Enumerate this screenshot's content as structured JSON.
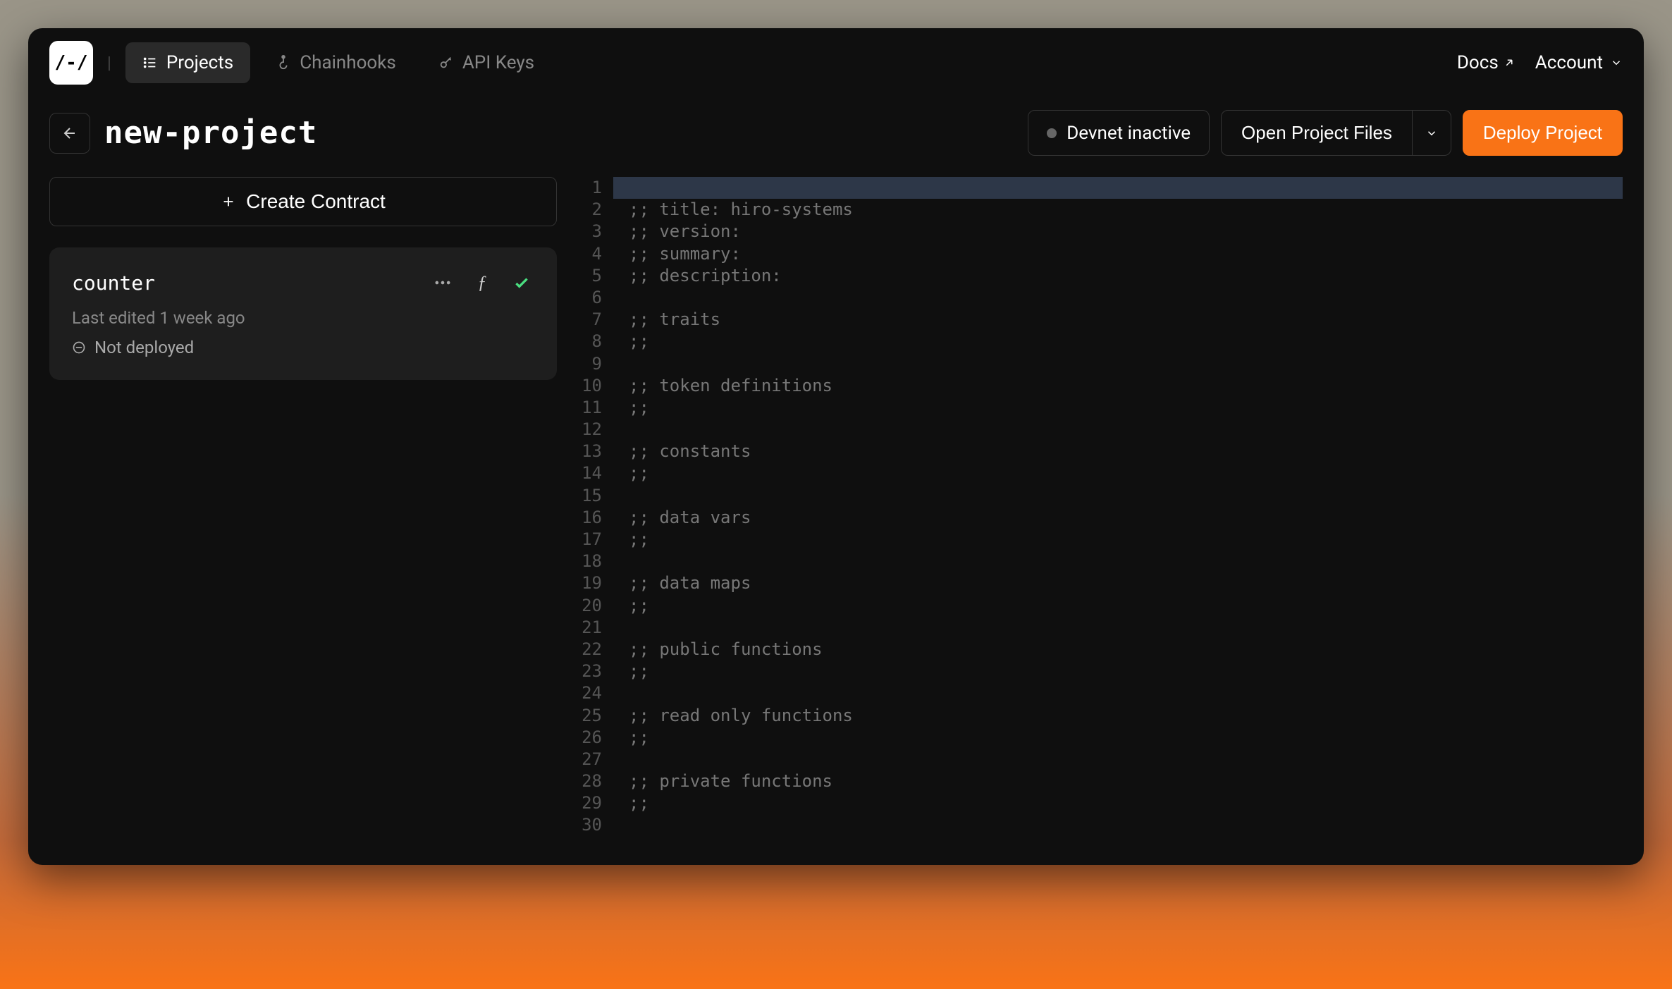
{
  "logo": "/-/",
  "nav": {
    "projects": "Projects",
    "chainhooks": "Chainhooks",
    "api_keys": "API Keys"
  },
  "top_right": {
    "docs": "Docs",
    "account": "Account"
  },
  "project": {
    "title": "new-project",
    "devnet_status": "Devnet inactive",
    "open_files": "Open Project Files",
    "deploy": "Deploy Project"
  },
  "sidebar": {
    "create_contract": "Create Contract",
    "contract": {
      "name": "counter",
      "last_edited": "Last edited 1 week ago",
      "deploy_status": "Not deployed"
    }
  },
  "editor": {
    "lines": [
      "",
      ";; title: hiro-systems",
      ";; version:",
      ";; summary:",
      ";; description:",
      "",
      ";; traits",
      ";;",
      "",
      ";; token definitions",
      ";;",
      "",
      ";; constants",
      ";;",
      "",
      ";; data vars",
      ";;",
      "",
      ";; data maps",
      ";;",
      "",
      ";; public functions",
      ";;",
      "",
      ";; read only functions",
      ";;",
      "",
      ";; private functions",
      ";;",
      ""
    ]
  }
}
